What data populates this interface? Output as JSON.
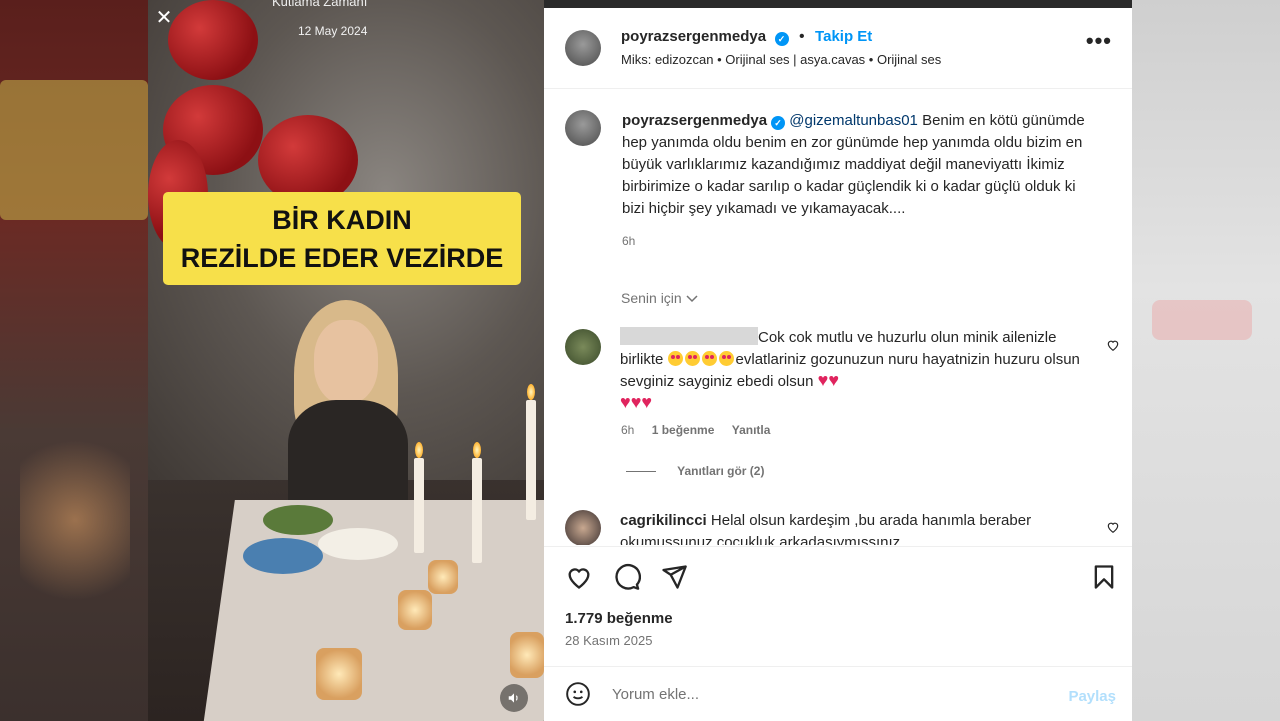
{
  "video": {
    "title": "Kutlama Zamanı",
    "date": "12 May 2024",
    "caption_line1": "BİR KADIN",
    "caption_line2": "REZİLDE EDER VEZİRDE"
  },
  "header": {
    "username": "poyrazsergenmedya",
    "separator": "•",
    "follow_label": "Takip Et",
    "audio_info": "Miks: edizozcan • Orijinal ses | asya.cavas • Orijinal ses",
    "more_label": "•••"
  },
  "post_caption": {
    "username": "poyrazsergenmedya",
    "mention": "@gizemaltunbas01",
    "text": "Benim en kötü günümde hep yanımda oldu benim en zor günümde hep yanımda oldu bizim en büyük varlıklarımız kazandığımız maddiyat değil maneviyattı İkimiz birbirimize o kadar sarılıp o kadar güçlendik ki o kadar güçlü olduk ki bizi hiçbir şey yıkamadı ve yıkamayacak....",
    "time": "6h"
  },
  "for_you_label": "Senin için",
  "comments": [
    {
      "text_part1": "Cok cok mutlu ve huzurlu olun minik ailenizle birlikte ",
      "text_part2": "evlatlariniz gozunuzun nuru hayatnizin huzuru olsun sevginiz sayginiz ebedi olsun ",
      "time": "6h",
      "likes": "1 beğenme",
      "reply_label": "Yanıtla",
      "view_replies": "Yanıtları gör (2)"
    },
    {
      "username": "cagrikilincci",
      "text": "Helal olsun kardeşim ,bu arada hanımla beraber okumussunuz cocukluk arkadasıymıssınız"
    }
  ],
  "likes_count": "1.779 beğenme",
  "post_date": "28 Kasım 2025",
  "comment_bar": {
    "placeholder": "Yorum ekle...",
    "share_label": "Paylaş"
  },
  "colors": {
    "accent": "#0095f6",
    "caption_bg": "#f7e04a",
    "heart_red": "#e0245e"
  },
  "icons": [
    "close-icon",
    "verified-icon",
    "more-icon",
    "like-icon",
    "comment-icon",
    "share-icon",
    "save-icon",
    "emoji-icon",
    "sound-icon",
    "chevron-down-icon"
  ]
}
